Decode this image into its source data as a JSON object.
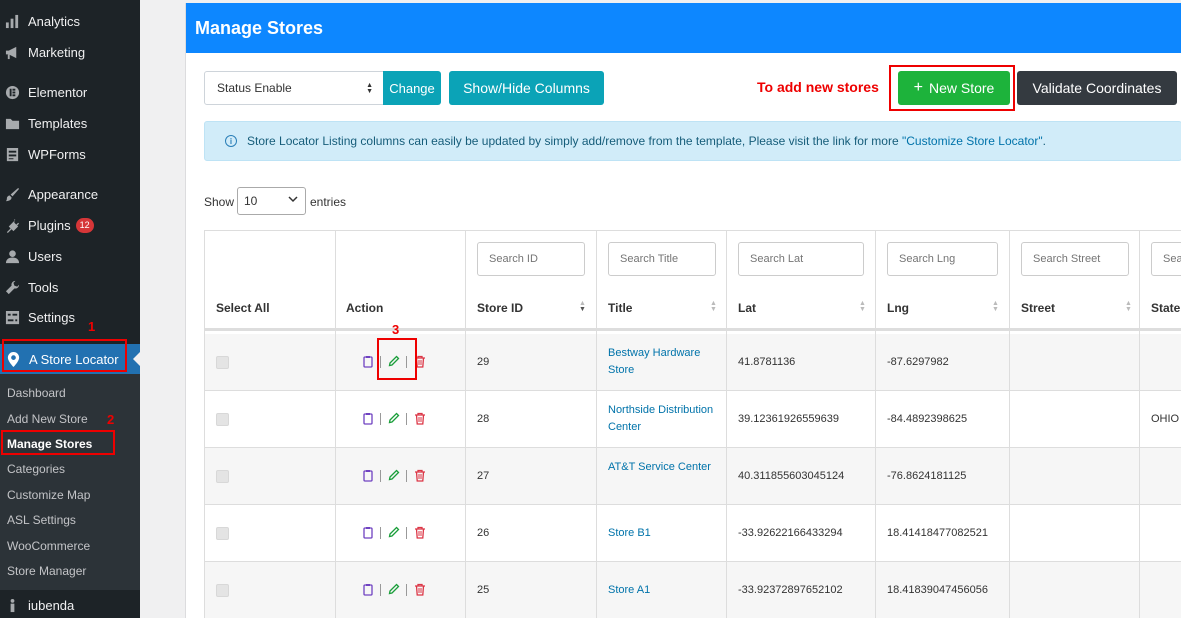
{
  "sidebar": {
    "menu": [
      {
        "label": "Analytics",
        "icon": "bar-chart-icon"
      },
      {
        "label": "Marketing",
        "icon": "megaphone-icon"
      },
      {
        "label": "Elementor",
        "icon": "elementor-icon"
      },
      {
        "label": "Templates",
        "icon": "folder-icon"
      },
      {
        "label": "WPForms",
        "icon": "form-icon"
      },
      {
        "label": "Appearance",
        "icon": "brush-icon"
      },
      {
        "label": "Plugins",
        "icon": "plug-icon",
        "badge": "12"
      },
      {
        "label": "Users",
        "icon": "user-icon"
      },
      {
        "label": "Tools",
        "icon": "wrench-icon"
      },
      {
        "label": "Settings",
        "icon": "settings-icon"
      }
    ],
    "active": {
      "label": "A Store Locator",
      "icon": "map-pin-icon"
    },
    "submenu": [
      "Dashboard",
      "Add New Store",
      "Manage Stores",
      "Categories",
      "Customize Map",
      "ASL Settings",
      "WooCommerce",
      "Store Manager"
    ],
    "footer": {
      "label": "iubenda"
    }
  },
  "annotations": {
    "one": "1",
    "two": "2",
    "three": "3",
    "add_hint": "To add new stores"
  },
  "panel": {
    "title": "Manage Stores",
    "status_select": "Status Enable",
    "change_label": "Change",
    "columns_label": "Show/Hide Columns",
    "new_store_plus": "+",
    "new_store_label": "New Store",
    "validate_label": "Validate Coordinates",
    "info_text": "Store Locator Listing columns can easily be updated by simply add/remove from the template, Please visit the link for more",
    "info_link": "\"Customize Store Locator\"",
    "info_end": ".",
    "show_label": "Show",
    "entries_value": "10",
    "entries_label": "entries"
  },
  "table": {
    "search_placeholders": {
      "id": "Search ID",
      "title": "Search Title",
      "lat": "Search Lat",
      "lng": "Search Lng",
      "street": "Search Street",
      "state": "Sea"
    },
    "headers": {
      "select": "Select All",
      "action": "Action",
      "id": "Store ID",
      "title": "Title",
      "lat": "Lat",
      "lng": "Lng",
      "street": "Street",
      "state": "State"
    },
    "rows": [
      {
        "id": "29",
        "title": "Bestway Hardware Store",
        "lat": "41.8781136",
        "lng": "-87.6297982",
        "street": "",
        "state": ""
      },
      {
        "id": "28",
        "title": "Northside Distribution Center",
        "lat": "39.12361926559639",
        "lng": "-84.4892398625",
        "street": "",
        "state": "OHIO"
      },
      {
        "id": "27",
        "title": "AT&T Service Center",
        "lat": "40.311855603045124",
        "lng": "-76.8624181125",
        "street": "",
        "state": ""
      },
      {
        "id": "26",
        "title": "Store B1",
        "lat": "-33.92622166433294",
        "lng": "18.41418477082521",
        "street": "",
        "state": ""
      },
      {
        "id": "25",
        "title": "Store A1",
        "lat": "-33.92372897652102",
        "lng": "18.41839047456056",
        "street": "",
        "state": ""
      }
    ]
  },
  "colors": {
    "header_blue": "#0d87ff",
    "teal": "#0ba3b7",
    "green": "#1db33b",
    "dark": "#343a40",
    "annotation_red": "#e00000",
    "wp_blue": "#2271b1"
  }
}
